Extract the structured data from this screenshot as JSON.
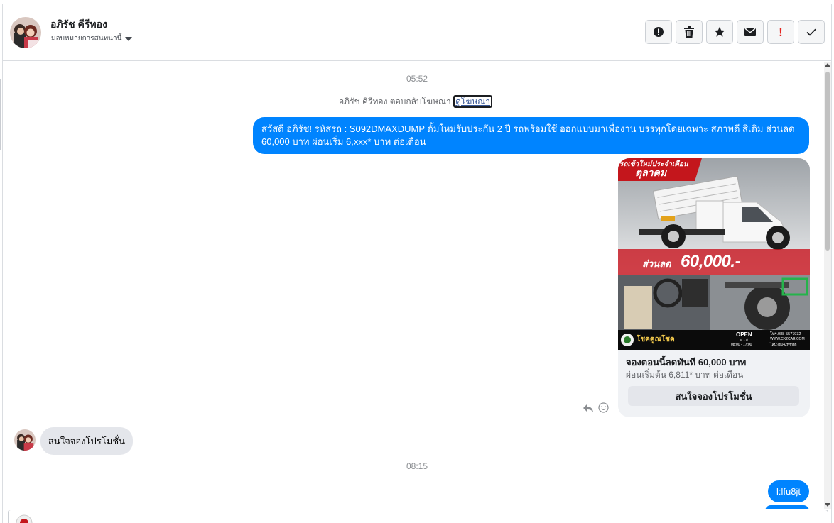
{
  "header": {
    "contact_name": "อภิรัช คีรีทอง",
    "assign_label": "มอบหมายการสนทนานี้"
  },
  "actions": [
    {
      "name": "alert-button",
      "icon": "alert-circle-icon"
    },
    {
      "name": "delete-button",
      "icon": "trash-icon"
    },
    {
      "name": "star-button",
      "icon": "star-icon"
    },
    {
      "name": "mark-unread-button",
      "icon": "envelope-icon"
    },
    {
      "name": "spam-button",
      "icon": "exclamation-icon"
    },
    {
      "name": "mark-done-button",
      "icon": "check-icon"
    }
  ],
  "thread": {
    "time_1": "05:52",
    "ad_reply_text": "อภิรัช คีรีทอง ตอบกลับโฆษณา",
    "ad_link_text": "ดูโฆษณา",
    "outgoing_message_1": "สวัสดี อภิรัช! รหัสรถ : S092DMAXDUMP ดั้มใหม่รับประกัน 2 ปี รถพร้อมใช้ ออกแบบมาเพื่องาน บรรทุกโดยเฉพาะ สภาพดี สีเดิม ส่วนลด 60,000 บาท  ผ่อนเริ่ม 6,xxx* บาท ต่อเดือน",
    "card": {
      "banner_line_1": "รถเข้าใหม่ประจำเดือน",
      "banner_line_2": "ตุลาคม",
      "discount_label": "ส่วนลด",
      "discount_value": "60,000.-",
      "brand_name": "โชคคูณโชค",
      "open_label": "OPEN",
      "open_days": "จ. - ส.",
      "open_hours": "08:00 - 17:00",
      "phone": "โทร.088-5577932",
      "website": "WWW.CK2CAR.COM",
      "line_id": "ไลน์:@042fvmnh",
      "title": "จองตอนนี้ลดทันที 60,000 บาท",
      "subtitle": "ผ่อนเริ่มต้น 6,811* บาท ต่อเดือน",
      "button_label": "สนใจจองโปรโมชั่น"
    },
    "incoming_message_1": "สนใจจองโปรโมชั่น",
    "time_2": "08:15",
    "outgoing_message_2": "l:lfu8jt"
  },
  "colors": {
    "outgoing_bubble": "#0084ff",
    "incoming_bubble": "#e4e6eb",
    "card_bg": "#f0f2f5",
    "spam_red": "#e4241f"
  }
}
